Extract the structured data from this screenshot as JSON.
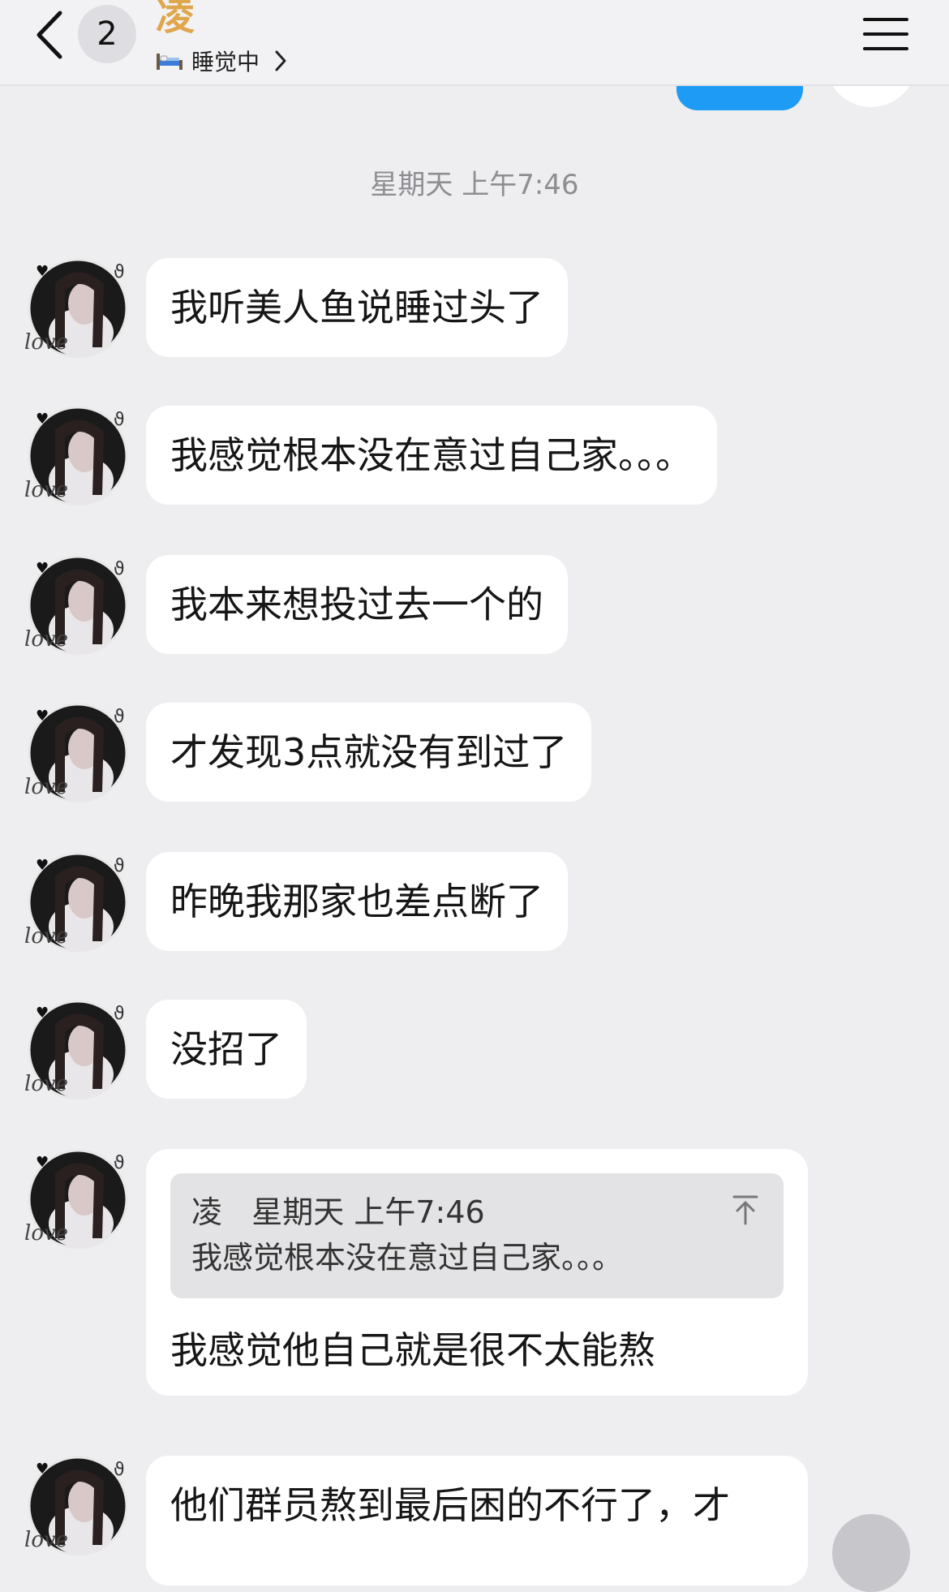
{
  "header": {
    "unread_count": "2",
    "contact_name": "凌",
    "status_text": "睡觉中"
  },
  "timestamp": "星期天 上午7:46",
  "messages": [
    {
      "text": "我听美人鱼说睡过头了"
    },
    {
      "text": "我感觉根本没在意过自己家。。。"
    },
    {
      "text": "我本来想投过去一个的"
    },
    {
      "text": "才发现3点就没有到过了"
    },
    {
      "text": "昨晚我那家也差点断了"
    },
    {
      "text": "没招了"
    }
  ],
  "reply_message": {
    "quote_author": "凌",
    "quote_time": "星期天 上午7:46",
    "quote_text": "我感觉根本没在意过自己家。。。",
    "text": "我感觉他自己就是很不太能熬"
  },
  "last_message": {
    "text": "他们群员熬到最后困的不行了，才"
  },
  "colors": {
    "background": "#eeeef0",
    "bubble": "#ffffff",
    "name": "#e0a64b",
    "sent_bubble": "#1d9bf5"
  },
  "icons": {
    "back": "chevron-left-icon",
    "status": "bed-icon",
    "status_more": "chevron-right-icon",
    "menu": "hamburger-menu-icon",
    "quote_jump": "jump-to-top-icon"
  }
}
